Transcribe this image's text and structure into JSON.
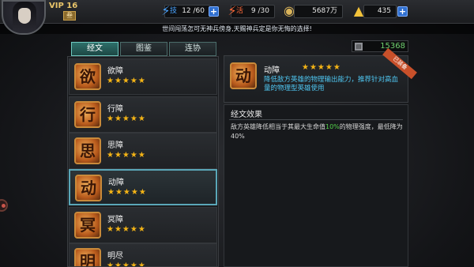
{
  "player": {
    "vip": "VIP 16",
    "level_badge": "叁"
  },
  "resources": [
    {
      "icon": "lightning-icon",
      "label": "技",
      "value": "12 /60",
      "color": "#4aa3ff"
    },
    {
      "icon": "flame-icon",
      "label": "活",
      "value": "9 /30",
      "color": "#ff6a3a"
    },
    {
      "icon": "coin-icon",
      "label": "",
      "value": "5687万",
      "color": "#d9b35a"
    },
    {
      "icon": "gold-ingot-icon",
      "label": "",
      "value": "435",
      "color": "#f2c23a"
    }
  ],
  "marquee": "世间闯荡怎可无神兵傍身,天赐神兵定是你无悔的选择!",
  "tabs": [
    {
      "label": "经文",
      "active": true
    },
    {
      "label": "图鉴",
      "active": false
    },
    {
      "label": "连协",
      "active": false
    }
  ],
  "items": [
    {
      "name": "欲障",
      "stars": "★★★★★",
      "glyph": "欲"
    },
    {
      "name": "行障",
      "stars": "★★★★★",
      "glyph": "行"
    },
    {
      "name": "思障",
      "stars": "★★★★★",
      "glyph": "思"
    },
    {
      "name": "动障",
      "stars": "★★★★★",
      "glyph": "动"
    },
    {
      "name": "冥障",
      "stars": "★★★★★",
      "glyph": "冥"
    },
    {
      "name": "明尽",
      "stars": "★★★★★",
      "glyph": "明"
    }
  ],
  "currency_box": {
    "value": "15368"
  },
  "detail": {
    "name": "动障",
    "stars": "★★★★★",
    "ribbon": "已装备",
    "description": "降低敌方英雄的物理输出能力，推荐针对高血量的物理型英雄使用"
  },
  "effect": {
    "title": "经文效果",
    "text_before": "敌方英雄降低相当于其最大生命值",
    "highlight": "10%",
    "text_after": "的物理强度，最低降为40%"
  }
}
